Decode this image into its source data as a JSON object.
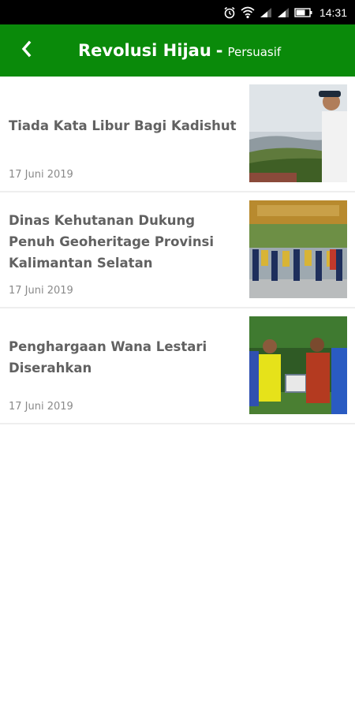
{
  "status_bar": {
    "time": "14:31",
    "icons": [
      "alarm-icon",
      "wifi-icon",
      "signal-icon",
      "signal-icon",
      "battery-icon"
    ]
  },
  "app_bar": {
    "back_icon": "chevron-left-icon",
    "title": "Revolusi Hijau",
    "separator": "-",
    "subtitle": "Persuasif",
    "color": "#0a8a0a"
  },
  "articles": [
    {
      "title": "Tiada Kata Libur Bagi Kadishut",
      "date": "17 Juni 2019"
    },
    {
      "title": "Dinas Kehutanan Dukung Penuh Geoheritage Provinsi Kalimantan Selatan",
      "date": "17 Juni 2019"
    },
    {
      "title": "Penghargaan Wana Lestari Diserahkan",
      "date": "17 Juni 2019"
    }
  ]
}
